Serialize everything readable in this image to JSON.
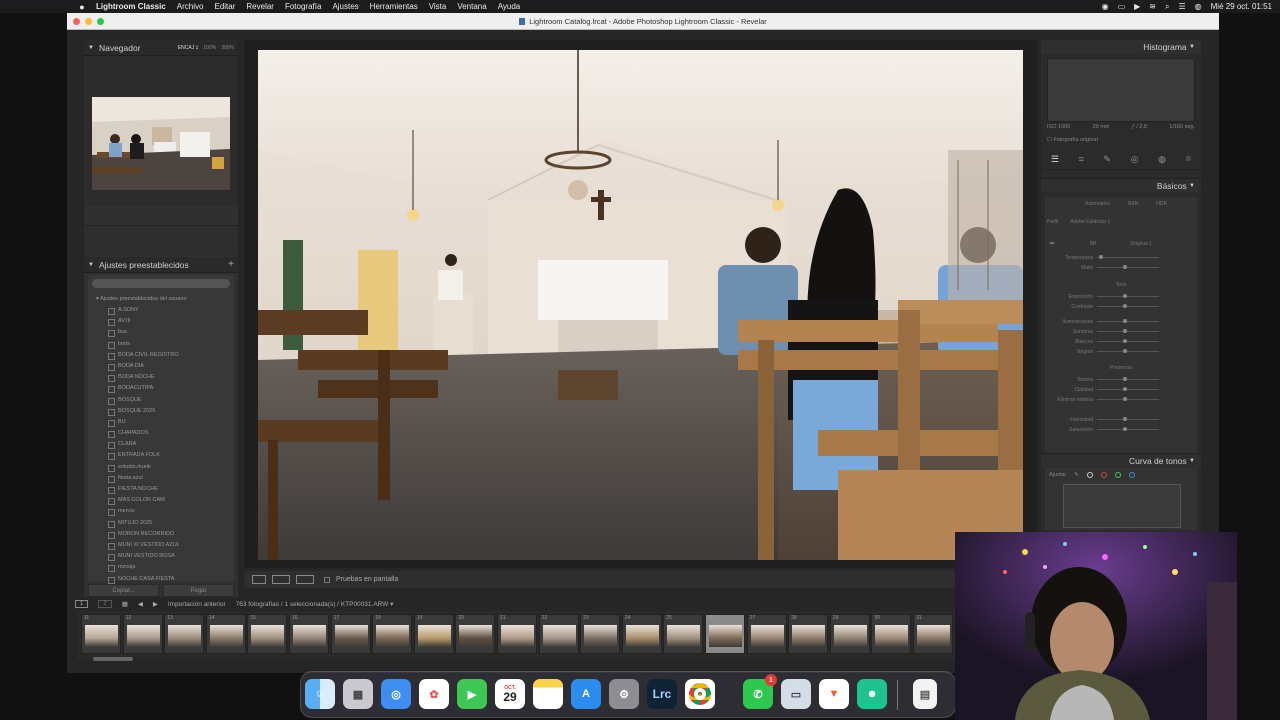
{
  "menubar": {
    "app": "Lightroom Classic",
    "items": [
      "Archivo",
      "Editar",
      "Revelar",
      "Fotografía",
      "Ajustes",
      "Herramientas",
      "Vista",
      "Ventana",
      "Ayuda"
    ],
    "clock": "Mié 29 oct.  01:51"
  },
  "window": {
    "title": "Lightroom Catalog.lrcat - Adobe Photoshop Lightroom Classic - Revelar"
  },
  "left_panel": {
    "navigator": {
      "title": "Navegador",
      "options": [
        "ENCAJ ‡",
        "100%",
        "300%"
      ]
    },
    "presets": {
      "title": "Ajustes preestablecidos",
      "group": "Ajustes preestablecidos del usuario",
      "items": [
        "A.SONY",
        "AV.III",
        "bus",
        "boris",
        "BODA CIVIL REGISTRO",
        "BODA DIA",
        "BODA NOCHE",
        "BODACUTIPA",
        "BOSQUE",
        "BOSQUE 2025",
        "BU",
        "CHAPADOS",
        "CLARA",
        "ENTRADA FOLK",
        "estudio.rkunk",
        "fiesta azul",
        "FIESTA NOCHE",
        "MAS COLOR CAM",
        "menos",
        "MITUJO 2025",
        "MORON RECORRIDO",
        "MUNI XI VESTIDO AZUL",
        "MUNI VESTIDO ROSA",
        "mzvaja",
        "NOCHE CASA FIESTA"
      ]
    },
    "buttons": {
      "copy": "Copiar...",
      "paste": "Pegar"
    }
  },
  "toolbar": {
    "softproof": "Pruebas en pantalla"
  },
  "right_panel": {
    "histogram": {
      "title": "Histograma",
      "iso": "ISO 1000",
      "focal": "29 mm",
      "aperture": "ƒ / 2,8",
      "shutter": "1/160 seg.",
      "original": "Fotografía original"
    },
    "basic": {
      "title": "Básicos",
      "tabs": [
        "Automático",
        "B&N",
        "HDR"
      ],
      "profile_label": "Perfil",
      "profile": "Adobe Estándar ‡",
      "wb_label": "BB",
      "wb_value": "Original ‡",
      "sliders": [
        "Temperatura",
        "Matiz",
        "",
        "Exposición",
        "Contraste",
        "",
        "Iluminaciones",
        "Sombras",
        "Blancos",
        "Negros",
        "",
        "Textura",
        "Claridad",
        "Eliminar neblina",
        "",
        "Intensidad",
        "Saturación"
      ],
      "tono": "Tono",
      "presencia": "Presencia"
    },
    "curve": {
      "title": "Curva de tonos",
      "adjust": "Ajustar"
    }
  },
  "filmstrip": {
    "source": "Importación anterior",
    "info": "763 fotografías / 1 seleccionada(s) / KTP00031.ARW ▾",
    "page1": "1",
    "page2": "2",
    "thumbs": [
      {
        "n": "11",
        "c": "#b5a695"
      },
      {
        "n": "12",
        "c": "#a89a8c"
      },
      {
        "n": "13",
        "c": "#9c8c7c"
      },
      {
        "n": "14",
        "c": "#8c7b6a"
      },
      {
        "n": "15",
        "c": "#a2917e"
      },
      {
        "n": "16",
        "c": "#96857a"
      },
      {
        "n": "17",
        "c": "#6b5a48"
      },
      {
        "n": "18",
        "c": "#7a6753"
      },
      {
        "n": "19",
        "c": "#b89a68"
      },
      {
        "n": "20",
        "c": "#5e4f41"
      },
      {
        "n": "21",
        "c": "#b09a86"
      },
      {
        "n": "22",
        "c": "#a5968a"
      },
      {
        "n": "23",
        "c": "#7d7065"
      },
      {
        "n": "24",
        "c": "#a88e6a"
      },
      {
        "n": "25",
        "c": "#a09080"
      },
      {
        "n": "26",
        "c": "#7d6a56"
      },
      {
        "n": "27",
        "c": "#9a8572"
      },
      {
        "n": "28",
        "c": "#8f7c6a"
      },
      {
        "n": "29",
        "c": "#928474"
      },
      {
        "n": "30",
        "c": "#9e8b78"
      },
      {
        "n": "31",
        "c": "#8c7a68"
      }
    ],
    "selected_index": 15
  },
  "dock": {
    "calendar_month": "OCT.",
    "calendar_day": "29",
    "lrc": "Lrc",
    "whatsapp_badge": "1"
  }
}
